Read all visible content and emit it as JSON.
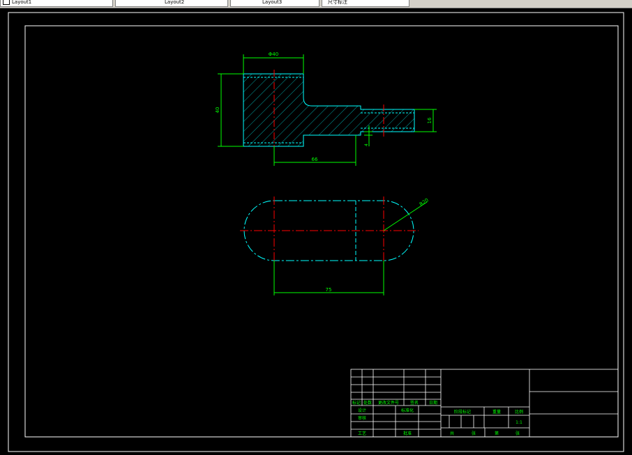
{
  "tabs": [
    {
      "label": "Layout1",
      "icon": "document-icon"
    },
    {
      "label": "Layout2"
    },
    {
      "label": "Layout3"
    },
    {
      "label": "尺寸标注"
    }
  ],
  "dims": {
    "top_width": "Φ40",
    "height": "40",
    "shaft_dia": "16",
    "offset": "66",
    "small_gap": "4",
    "radius": "R20",
    "length": "75"
  },
  "title_block": {
    "rev_headers": [
      "标记",
      "处数",
      "更改文件号",
      "签名",
      "日期"
    ],
    "design": "设计",
    "standardize": "标准化",
    "check": "审核",
    "process": "工艺",
    "approve": "批准",
    "stage_mark": "阶段标记",
    "weight": "重量",
    "scale": "比例",
    "scale_value": "1:1",
    "sheets": "共",
    "sheet_unit": "张",
    "sheet_no": "第",
    "sheet_no_unit": "张"
  },
  "colors": {
    "background": "#000000",
    "frame": "#ffffff",
    "dimension": "#00ff00",
    "outline": "#00ffff",
    "center": "#ff0000",
    "hatch": "#00ffff"
  }
}
